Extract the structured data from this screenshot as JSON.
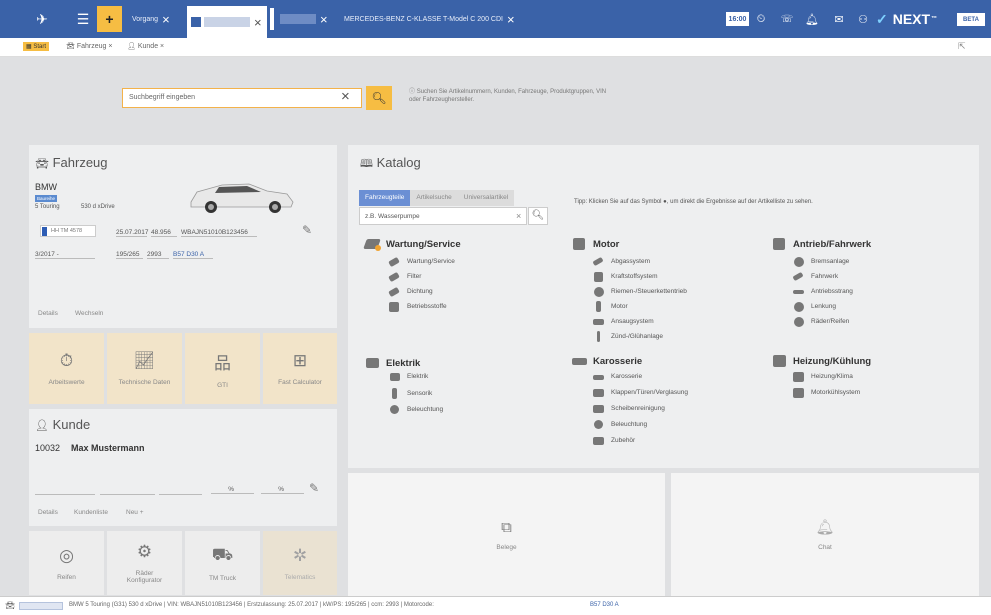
{
  "topbar": {
    "tab1": "Vorgang",
    "tab4": "MERCEDES-BENZ C-KLASSE T-Model C 200 CDI",
    "time": "16:00",
    "brand": "NEXT",
    "beta": "BETA",
    "plus": "+"
  },
  "subbar": {
    "start": "Start",
    "fahrzeug": "Fahrzeug",
    "kunde": "Kunde"
  },
  "search": {
    "placeholder": "Suchbegriff eingeben",
    "hint": "Suchen Sie Artikelnummern, Kunden, Fahrzeuge, Produktgruppen, VIN oder Fahrzeughersteller."
  },
  "vehicle": {
    "title": "Fahrzeug",
    "make": "BMW",
    "model_badge": "Baureihe",
    "model": "5 Touring",
    "variant": "530 d xDrive",
    "plate": "HH TM 4578",
    "date": "25.07.2017",
    "km": "48.956",
    "vin": "WBAJN51010B123456",
    "year": "3/2017 -",
    "power": "195/265",
    "ccm": "2993",
    "motor": "B57 D30 A",
    "details": "Details",
    "wechseln": "Wechseln"
  },
  "tiles": [
    {
      "label": "Arbeitswerte",
      "icon": "clock-gear-icon"
    },
    {
      "label": "Technische Daten",
      "icon": "chart-icon"
    },
    {
      "label": "GTI",
      "icon": "sitemap-icon"
    },
    {
      "label": "Fast Calculator",
      "icon": "calculator-icon"
    }
  ],
  "customer": {
    "title": "Kunde",
    "number": "10032",
    "name": "Max Mustermann",
    "pct1": "%",
    "pct2": "%",
    "details": "Details",
    "kundenliste": "Kundenliste",
    "neu": "Neu"
  },
  "tiles2": [
    {
      "label": "Reifen",
      "icon": "tire-icon"
    },
    {
      "label": "Räder Konfigurator",
      "icon": "wheel-car-icon"
    },
    {
      "label": "TM Truck",
      "icon": "truck-icon"
    },
    {
      "label": "Telematics",
      "icon": "telematics-icon"
    }
  ],
  "catalog": {
    "title": "Katalog",
    "tabs": [
      "Fahrzeugteile",
      "Artikelsuche",
      "Universalartikel"
    ],
    "search_placeholder": "z.B. Wasserpumpe",
    "tip": "Tipp: Klicken Sie auf das Symbol ●, um direkt die Ergebnisse auf der Artikelliste zu sehen.",
    "groups": [
      {
        "title": "Wartung/Service",
        "items": [
          "Wartung/Service",
          "Filter",
          "Dichtung",
          "Betriebsstoffe"
        ]
      },
      {
        "title": "Motor",
        "items": [
          "Abgassystem",
          "Kraftstoffsystem",
          "Riemen-/Steuerkettentrieb",
          "Motor",
          "Ansaugsystem",
          "Zünd-/Glühanlage"
        ]
      },
      {
        "title": "Antrieb/Fahrwerk",
        "items": [
          "Bremsanlage",
          "Fahrwerk",
          "Antriebsstrang",
          "Lenkung",
          "Räder/Reifen"
        ]
      },
      {
        "title": "Elektrik",
        "items": [
          "Elektrik",
          "Sensorik",
          "Beleuchtung"
        ]
      },
      {
        "title": "Karosserie",
        "items": [
          "Karosserie",
          "Klappen/Türen/Verglasung",
          "Scheibenreinigung",
          "Beleuchtung",
          "Zubehör"
        ]
      },
      {
        "title": "Heizung/Kühlung",
        "items": [
          "Heizung/Klima",
          "Motorkühlsystem"
        ]
      }
    ]
  },
  "widgets": {
    "belege": "Belege",
    "chat": "Chat"
  },
  "status": {
    "text": "BMW 5 Touring (G31) 530 d xDrive | VIN: WBAJN51010B123456 | Erstzulassung: 25.07.2017 | kW/PS: 195/265 | ccm: 2993 | Motorcode:",
    "code": "B57 D30 A"
  }
}
